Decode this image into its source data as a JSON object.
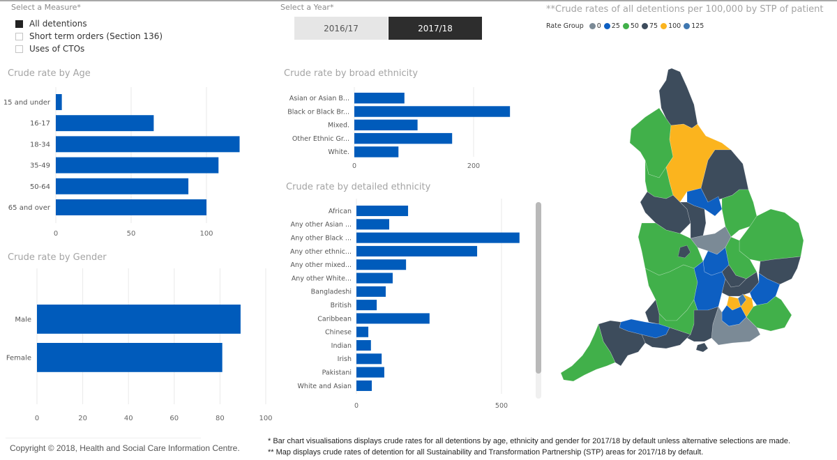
{
  "measure_slicer": {
    "title": "Select a Measure*",
    "items": [
      {
        "label": "All detentions",
        "checked": true
      },
      {
        "label": "Short term orders (Section 136)",
        "checked": false
      },
      {
        "label": "Uses of CTOs",
        "checked": false
      }
    ]
  },
  "year_slicer": {
    "title": "Select a Year*",
    "options": [
      {
        "label": "2016/17",
        "selected": false
      },
      {
        "label": "2017/18",
        "selected": true
      }
    ]
  },
  "map": {
    "title": "**Crude rates of all detentions per 100,000 by STP of patient",
    "legend_title": "Rate Group",
    "legend": [
      {
        "label": "0",
        "color": "#7b8a96"
      },
      {
        "label": "25",
        "color": "#0d5fc2"
      },
      {
        "label": "50",
        "color": "#41b04a"
      },
      {
        "label": "75",
        "color": "#3d4c5c"
      },
      {
        "label": "100",
        "color": "#fbb41e"
      },
      {
        "label": "125",
        "color": "#3f77b0"
      }
    ]
  },
  "colors": {
    "bar": "#005bbb",
    "grid": "#eaeaea",
    "tick": "#666666"
  },
  "chart_data": [
    {
      "id": "age",
      "type": "bar",
      "orientation": "horizontal",
      "title": "Crude rate by Age",
      "categories": [
        "15 and under",
        "16-17",
        "18-34",
        "35-49",
        "50-64",
        "65 and over"
      ],
      "values": [
        4,
        65,
        122,
        108,
        88,
        100
      ],
      "xticks": [
        0,
        50,
        100
      ],
      "xlim": [
        0,
        125
      ],
      "grid": true
    },
    {
      "id": "gender",
      "type": "bar",
      "orientation": "horizontal",
      "title": "Crude rate by Gender",
      "categories": [
        "Male",
        "Female"
      ],
      "values": [
        89,
        81
      ],
      "xticks": [
        0,
        20,
        40,
        60,
        80,
        100
      ],
      "xlim": [
        0,
        100
      ],
      "grid": true
    },
    {
      "id": "broad",
      "type": "bar",
      "orientation": "horizontal",
      "title": "Crude rate by broad ethnicity",
      "categories": [
        "Asian or Asian B...",
        "Black or Black Br...",
        "Mixed.",
        "Other Ethnic Gr...",
        "White."
      ],
      "values": [
        84,
        261,
        106,
        164,
        74
      ],
      "xticks": [
        0,
        200
      ],
      "xlim": [
        0,
        300
      ],
      "grid": true
    },
    {
      "id": "detailed",
      "type": "bar",
      "orientation": "horizontal",
      "title": "Crude rate by detailed ethnicity",
      "categories": [
        "African",
        "Any other Asian ...",
        "Any other Black ...",
        "Any other ethnic...",
        "Any other mixed...",
        "Any other White...",
        "Bangladeshi",
        "British",
        "Caribbean",
        "Chinese",
        "Indian",
        "Irish",
        "Pakistani",
        "White and Asian"
      ],
      "values": [
        178,
        113,
        562,
        416,
        171,
        125,
        101,
        70,
        252,
        41,
        50,
        87,
        96,
        53
      ],
      "xticks": [
        0,
        500
      ],
      "xlim": [
        0,
        600
      ],
      "grid": true
    }
  ],
  "footer": {
    "copyright": "Copyright © 2018, Health and Social Care Information Centre.",
    "note1": "* Bar chart visualisations displays crude rates for all detentions by age, ethnicity and gender for 2017/18 by default unless alternative selections are made.",
    "note2": "** Map displays crude rates of detention for all Sustainability and Transformation Partnership (STP) areas for 2017/18 by default."
  }
}
